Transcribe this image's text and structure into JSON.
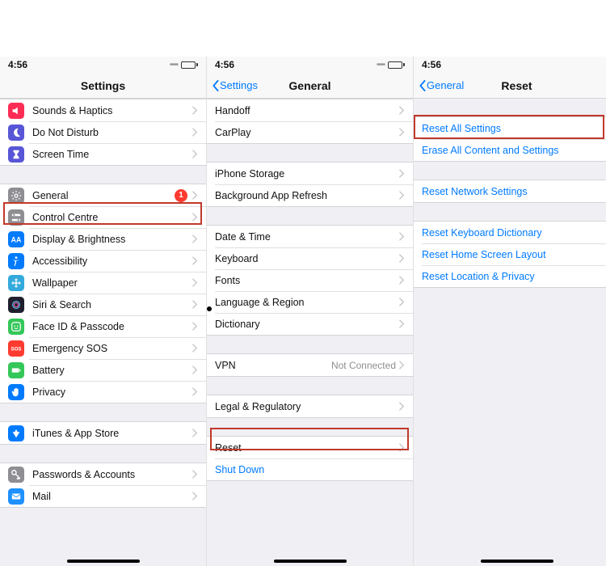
{
  "status": {
    "time": "4:56"
  },
  "screen1": {
    "title": "Settings",
    "group1": [
      {
        "label": "Sounds & Haptics",
        "icon": "speaker-icon",
        "color": "#ff2d55"
      },
      {
        "label": "Do Not Disturb",
        "icon": "moon-icon",
        "color": "#5856d6"
      },
      {
        "label": "Screen Time",
        "icon": "hourglass-icon",
        "color": "#5856d6"
      }
    ],
    "group2": [
      {
        "label": "General",
        "icon": "gear-icon",
        "color": "#8e8e93",
        "badge": "1"
      },
      {
        "label": "Control Centre",
        "icon": "switches-icon",
        "color": "#8e8e93"
      },
      {
        "label": "Display & Brightness",
        "icon": "aa-icon",
        "color": "#007aff"
      },
      {
        "label": "Accessibility",
        "icon": "accessibility-icon",
        "color": "#007aff"
      },
      {
        "label": "Wallpaper",
        "icon": "flower-icon",
        "color": "#34aadc"
      },
      {
        "label": "Siri & Search",
        "icon": "siri-icon",
        "color": "#1f1f2e"
      },
      {
        "label": "Face ID & Passcode",
        "icon": "face-icon",
        "color": "#34c759"
      },
      {
        "label": "Emergency SOS",
        "icon": "sos-icon",
        "color": "#ff3b30"
      },
      {
        "label": "Battery",
        "icon": "battery-icon",
        "color": "#34c759"
      },
      {
        "label": "Privacy",
        "icon": "hand-icon",
        "color": "#007aff"
      }
    ],
    "group3": [
      {
        "label": "iTunes & App Store",
        "icon": "appstore-icon",
        "color": "#007aff"
      }
    ],
    "group4": [
      {
        "label": "Passwords & Accounts",
        "icon": "key-icon",
        "color": "#8e8e93"
      },
      {
        "label": "Mail",
        "icon": "mail-icon",
        "color": "#1e90ff"
      }
    ]
  },
  "screen2": {
    "back": "Settings",
    "title": "General",
    "group1": [
      {
        "label": "Handoff"
      },
      {
        "label": "CarPlay"
      }
    ],
    "group2": [
      {
        "label": "iPhone Storage"
      },
      {
        "label": "Background App Refresh"
      }
    ],
    "group3": [
      {
        "label": "Date & Time"
      },
      {
        "label": "Keyboard"
      },
      {
        "label": "Fonts"
      },
      {
        "label": "Language & Region"
      },
      {
        "label": "Dictionary"
      }
    ],
    "group4": [
      {
        "label": "VPN",
        "detail": "Not Connected"
      }
    ],
    "group5": [
      {
        "label": "Legal & Regulatory"
      }
    ],
    "group6": [
      {
        "label": "Reset"
      },
      {
        "label": "Shut Down",
        "link": true,
        "nochev": true
      }
    ]
  },
  "screen3": {
    "back": "General",
    "title": "Reset",
    "group1": [
      {
        "label": "Reset All Settings",
        "link": true,
        "nochev": true
      },
      {
        "label": "Erase All Content and Settings",
        "link": true,
        "nochev": true
      }
    ],
    "group2": [
      {
        "label": "Reset Network Settings",
        "link": true,
        "nochev": true
      }
    ],
    "group3": [
      {
        "label": "Reset Keyboard Dictionary",
        "link": true,
        "nochev": true
      },
      {
        "label": "Reset Home Screen Layout",
        "link": true,
        "nochev": true
      },
      {
        "label": "Reset Location & Privacy",
        "link": true,
        "nochev": true
      }
    ]
  }
}
